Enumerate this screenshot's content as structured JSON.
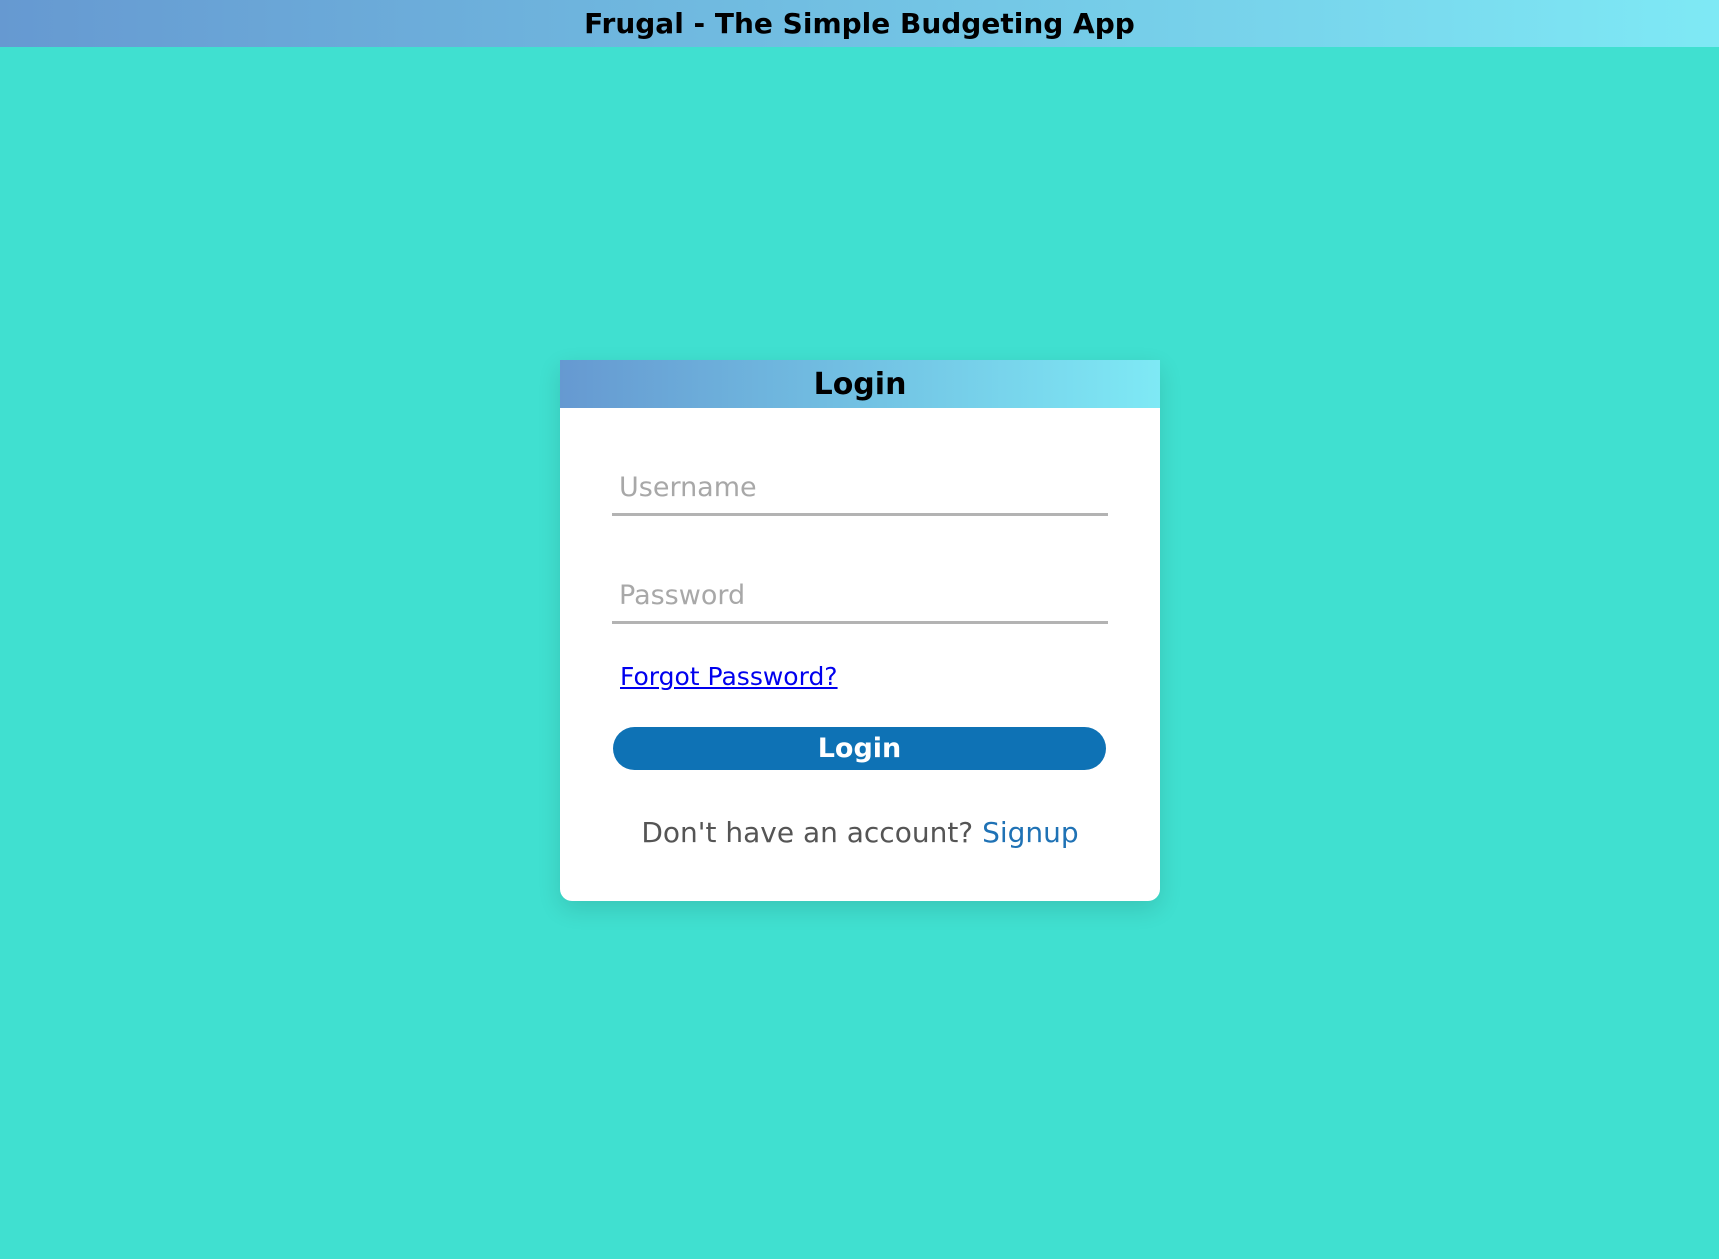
{
  "app": {
    "title": "Frugal - The Simple Budgeting App"
  },
  "login_card": {
    "title": "Login",
    "username": {
      "value": "",
      "placeholder": "Username"
    },
    "password": {
      "value": "",
      "placeholder": "Password"
    },
    "forgot_password_label": "Forgot Password?",
    "login_button_label": "Login",
    "signup_prompt": "Don't have an account?",
    "signup_link_label": "Signup"
  },
  "colors": {
    "background": "#40E0D0",
    "header_gradient_start": "#6699D1",
    "header_gradient_end": "#7EE9F5",
    "button": "#0E72B5",
    "link": "#0000EE",
    "signup_link": "#1F72B5"
  }
}
